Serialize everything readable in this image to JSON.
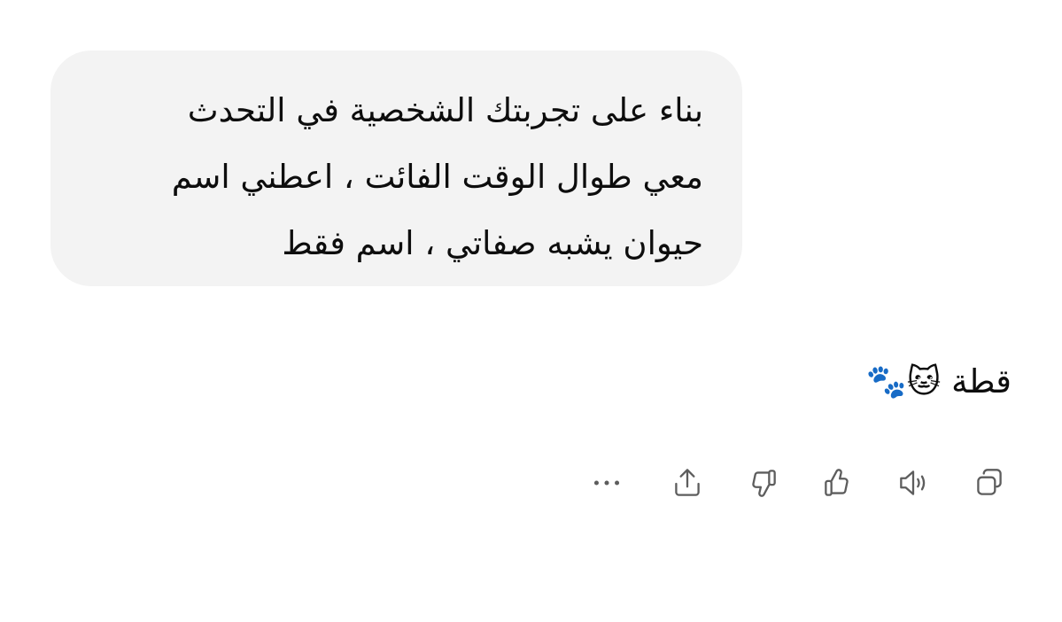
{
  "conversation": {
    "user_message": {
      "lines": [
        "بناء على تجربتك الشخصية في التحدث",
        "معي طوال الوقت الفائت ، اعطني اسم",
        "حيوان يشبه صفاتي ، اسم فقط"
      ]
    },
    "assistant_message": {
      "text": "قطة 🐱🐾"
    },
    "actions": [
      {
        "name": "copy",
        "icon": "copy-icon"
      },
      {
        "name": "read-aloud",
        "icon": "speaker-icon"
      },
      {
        "name": "good-response",
        "icon": "thumbs-up-icon"
      },
      {
        "name": "bad-response",
        "icon": "thumbs-down-icon"
      },
      {
        "name": "share",
        "icon": "share-icon"
      },
      {
        "name": "more",
        "icon": "more-icon"
      }
    ]
  },
  "colors": {
    "bubble_background": "#f3f3f3",
    "text": "#0d0d0d",
    "icon": "#5d5d5d"
  }
}
